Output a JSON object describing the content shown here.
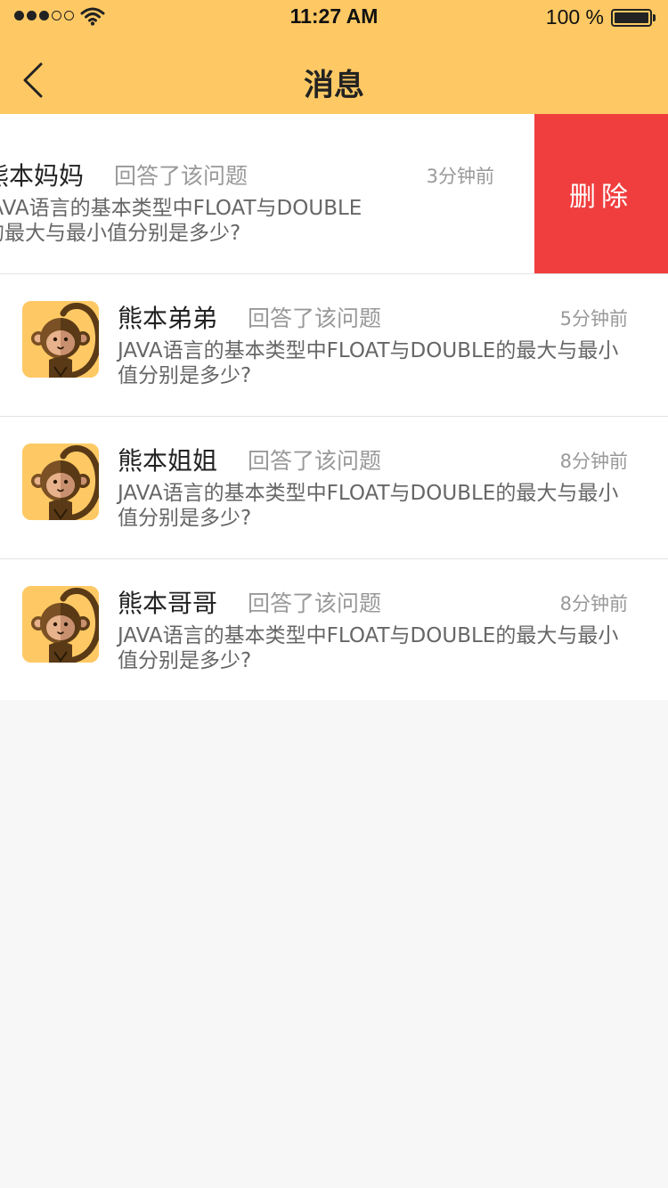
{
  "status_bar": {
    "time": "11:27 AM",
    "battery_text": "100 %",
    "signal_dots_filled": 3,
    "signal_dots_total": 5,
    "battery_level": 1.0
  },
  "nav": {
    "title": "消息",
    "back_icon": "chevron-left-icon"
  },
  "colors": {
    "header": "#fec964",
    "delete": "#f03e3e",
    "page_bg": "#f7f7f7"
  },
  "messages": [
    {
      "name": "熊本妈妈",
      "action": "回答了该问题",
      "time": "3分钟前",
      "question": "JAVA语言的基本类型中FLOAT与DOUBLE的最大与最小值分别是多少?",
      "swiped": true,
      "delete_label": "删除"
    },
    {
      "name": "熊本弟弟",
      "action": "回答了该问题",
      "time": "5分钟前",
      "question": "JAVA语言的基本类型中FLOAT与DOUBLE的最大与最小值分别是多少?"
    },
    {
      "name": "熊本姐姐",
      "action": "回答了该问题",
      "time": "8分钟前",
      "question": "JAVA语言的基本类型中FLOAT与DOUBLE的最大与最小值分别是多少?"
    },
    {
      "name": "熊本哥哥",
      "action": "回答了该问题",
      "time": "8分钟前",
      "question": "JAVA语言的基本类型中FLOAT与DOUBLE的最大与最小值分别是多少?"
    }
  ]
}
